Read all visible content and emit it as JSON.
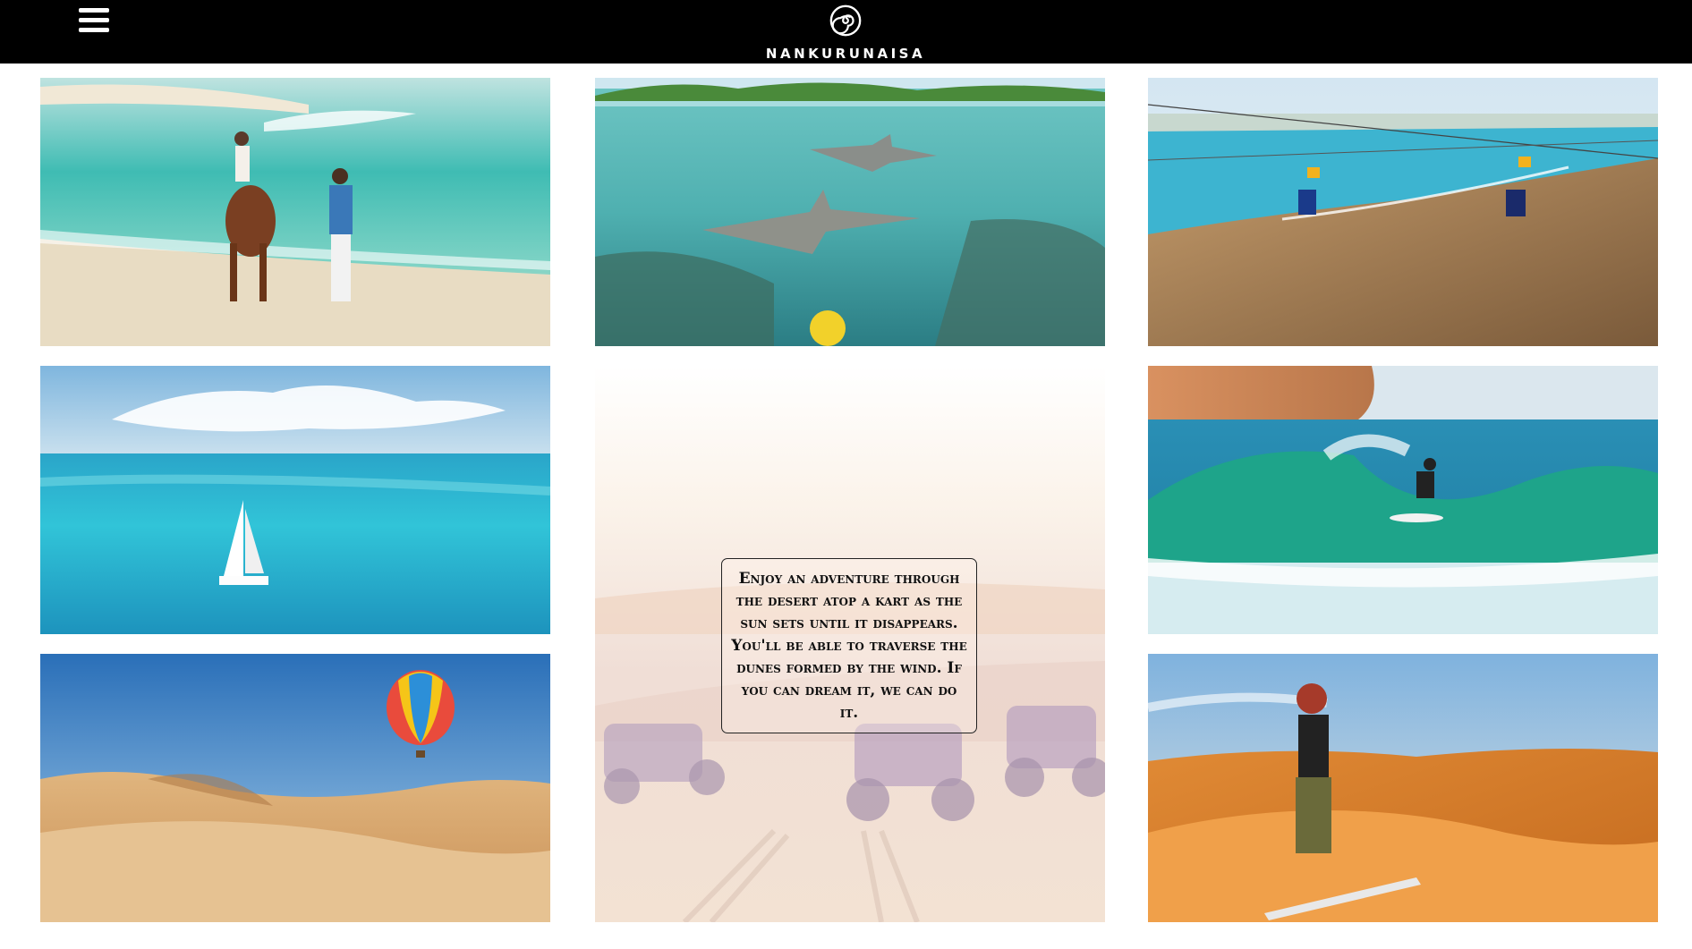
{
  "header": {
    "brand": "NANKURUNAISA",
    "menu_icon": "hamburger-icon",
    "logo_icon": "spiral-icon",
    "background": "#000000"
  },
  "gallery": {
    "tiles": [
      {
        "name": "horse-beach-photo",
        "subject": "couple with horse on beach"
      },
      {
        "name": "shark-reef-photo",
        "subject": "sharks over coral reef"
      },
      {
        "name": "zipline-photo",
        "subject": "zipline over coastline"
      },
      {
        "name": "catamaran-photo",
        "subject": "catamaran on turquoise sea"
      },
      {
        "name": "quad-desert-photo",
        "subject": "quad bikes in desert at sunset"
      },
      {
        "name": "surf-photo",
        "subject": "surfer riding wave"
      },
      {
        "name": "balloon-desert-photo",
        "subject": "hot air balloon over dunes"
      },
      {
        "name": "sandboard-photo",
        "subject": "sandboarder on dune"
      }
    ],
    "caption": "Enjoy an adventure through the desert atop a kart as the sun sets until it disappears. You'll be able to traverse the dunes formed by the wind. If you can dream it, we can do it."
  }
}
